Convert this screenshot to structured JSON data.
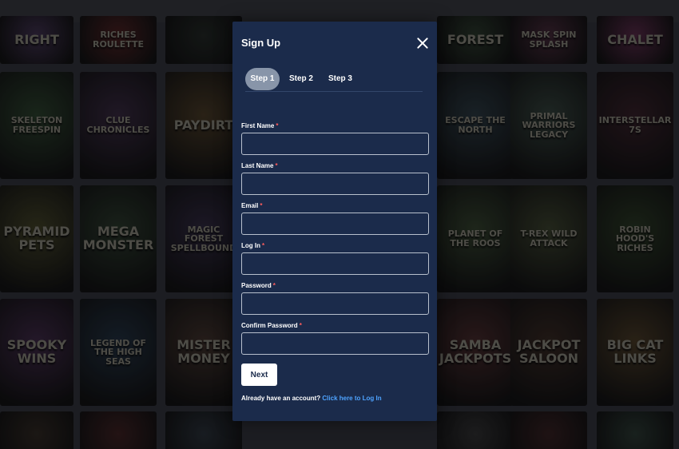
{
  "modal": {
    "title": "Sign Up",
    "close_icon": "close-icon",
    "steps": [
      {
        "label": "Step 1",
        "active": true
      },
      {
        "label": "Step 2",
        "active": false
      },
      {
        "label": "Step 3",
        "active": false
      }
    ],
    "fields": [
      {
        "label": "First Name",
        "required": "*",
        "value": ""
      },
      {
        "label": "Last Name",
        "required": "*",
        "value": ""
      },
      {
        "label": "Email",
        "required": "*",
        "value": ""
      },
      {
        "label": "Log In",
        "required": "*",
        "value": ""
      },
      {
        "label": "Password",
        "required": "*",
        "value": ""
      },
      {
        "label": "Confirm Password",
        "required": "*",
        "value": ""
      }
    ],
    "next_label": "Next",
    "login_prompt": "Already have an account?",
    "login_link": "Click here to Log In"
  },
  "background_games": [
    {
      "title": "Right",
      "color": "#6a4a8a"
    },
    {
      "title": "Riches Roulette",
      "color": "#8a2a2a"
    },
    {
      "title": "",
      "color": "#2e3a30"
    },
    {
      "title": "Forest",
      "color": "#3a5a3a"
    },
    {
      "title": "Mask Spin Splash",
      "color": "#7a3a5a"
    },
    {
      "title": "Chalet",
      "color": "#a03a7a"
    },
    {
      "title": "Skeleton Freespin",
      "color": "#3a6a3a"
    },
    {
      "title": "Clue Chronicles",
      "color": "#5a3a6a"
    },
    {
      "title": "Paydirt",
      "color": "#7a5a2a"
    },
    {
      "title": "Escape the North",
      "color": "#3a5a6a"
    },
    {
      "title": "Primal Warriors Legacy",
      "color": "#4a6a5a"
    },
    {
      "title": "Interstellar 7s",
      "color": "#5a2a3a"
    },
    {
      "title": "Pyramid Pets",
      "color": "#6a6a2a"
    },
    {
      "title": "Mega Monster",
      "color": "#3a5a3a"
    },
    {
      "title": "Magic Forest Spellbound",
      "color": "#4a3a6a"
    },
    {
      "title": "Planet of the Roos",
      "color": "#4a6a3a"
    },
    {
      "title": "T-Rex Wild Attack",
      "color": "#5a6a3a"
    },
    {
      "title": "Robin Hood's Riches",
      "color": "#3a5a2a"
    },
    {
      "title": "Spooky Wins",
      "color": "#6a3a7a"
    },
    {
      "title": "Legend of the High Seas",
      "color": "#2a4a6a"
    },
    {
      "title": "Mister Money",
      "color": "#6a4a3a"
    },
    {
      "title": "Samba Jackpots",
      "color": "#7a3a3a"
    },
    {
      "title": "Jackpot Saloon",
      "color": "#5a3a2a"
    },
    {
      "title": "Big Cat Links",
      "color": "#7a5a2a"
    },
    {
      "title": "",
      "color": "#4a3a2a"
    },
    {
      "title": "",
      "color": "#6a2a2a"
    },
    {
      "title": "",
      "color": "#3a4a5a"
    },
    {
      "title": "",
      "color": "#4a4a4a"
    },
    {
      "title": "",
      "color": "#5a2a2a"
    },
    {
      "title": "",
      "color": "#3a5a4a"
    },
    {
      "title": "",
      "color": "#5a3a2a"
    },
    {
      "title": "",
      "color": "#6a3a3a"
    }
  ]
}
